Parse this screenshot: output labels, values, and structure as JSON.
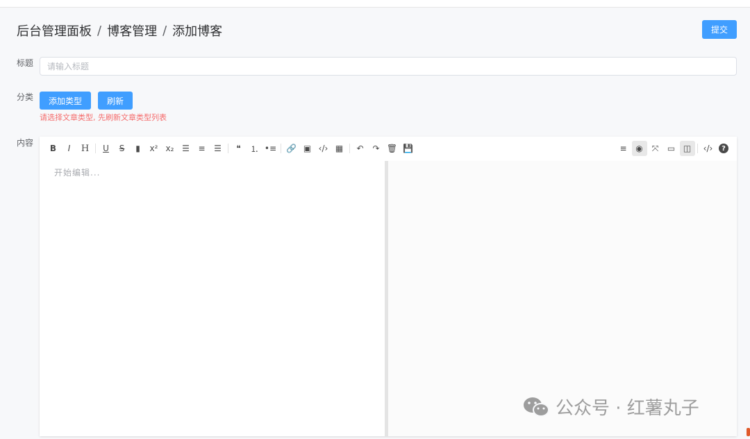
{
  "breadcrumb": [
    "后台管理面板",
    "博客管理",
    "添加博客"
  ],
  "breadcrumb_separator": "/",
  "submit_label": "提交",
  "fields": {
    "title_label": "标题",
    "title_placeholder": "请输入标题",
    "category_label": "分类",
    "content_label": "内容"
  },
  "category": {
    "add_type_label": "添加类型",
    "refresh_label": "刷新",
    "hint": "请选择文章类型, 先刷新文章类型列表"
  },
  "editor": {
    "placeholder": "开始编辑...",
    "toolbar_left": [
      {
        "name": "bold",
        "glyph": "B"
      },
      {
        "name": "italic",
        "glyph": "I"
      },
      {
        "name": "header",
        "glyph": "H"
      },
      {
        "sep": true
      },
      {
        "name": "underline",
        "glyph": "U"
      },
      {
        "name": "strikethrough",
        "glyph": "S"
      },
      {
        "name": "mark",
        "glyph": "▮"
      },
      {
        "name": "superscript",
        "glyph": "x²"
      },
      {
        "name": "subscript",
        "glyph": "x₂"
      },
      {
        "name": "align-left",
        "glyph": "☰"
      },
      {
        "name": "align-center",
        "glyph": "≡"
      },
      {
        "name": "align-right",
        "glyph": "☰"
      },
      {
        "sep": true
      },
      {
        "name": "quote",
        "glyph": "❝"
      },
      {
        "name": "ordered-list",
        "glyph": "⒈"
      },
      {
        "name": "unordered-list",
        "glyph": "•≡"
      },
      {
        "sep": true
      },
      {
        "name": "link",
        "glyph": "🔗"
      },
      {
        "name": "image",
        "glyph": "▣"
      },
      {
        "name": "code",
        "glyph": "‹/›"
      },
      {
        "name": "table",
        "glyph": "▦"
      },
      {
        "sep": true
      },
      {
        "name": "undo",
        "glyph": "↶"
      },
      {
        "name": "redo",
        "glyph": "↷"
      },
      {
        "name": "trash",
        "glyph": "🗑"
      },
      {
        "name": "save",
        "glyph": "💾"
      }
    ],
    "toolbar_right": [
      {
        "name": "navigation",
        "glyph": "≡"
      },
      {
        "name": "preview-toggle",
        "glyph": "◉",
        "active": true
      },
      {
        "name": "fullscreen",
        "glyph": "⤧"
      },
      {
        "name": "read-mode",
        "glyph": "▭"
      },
      {
        "name": "subfield",
        "glyph": "◫",
        "active": true
      },
      {
        "sep": true
      },
      {
        "name": "html-code",
        "glyph": "‹/›"
      },
      {
        "name": "help",
        "glyph": "?"
      }
    ]
  },
  "watermark": {
    "text": "公众号 · 红薯丸子",
    "icon": "wechat-icon"
  },
  "colors": {
    "primary": "#409eff",
    "danger": "#f56c6c"
  }
}
